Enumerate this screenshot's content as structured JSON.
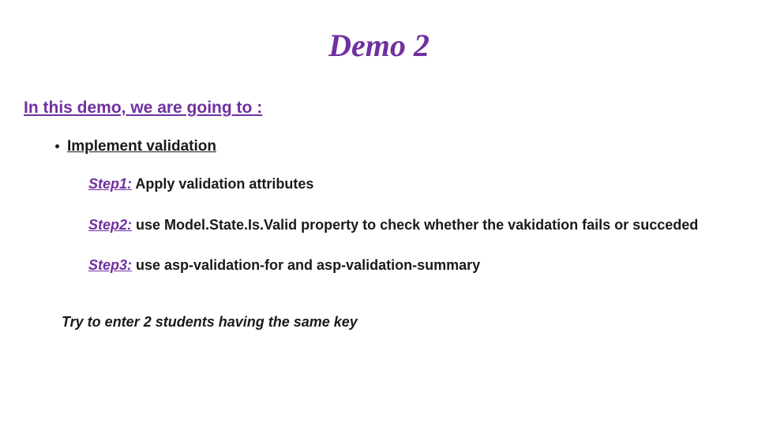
{
  "title": "Demo 2",
  "intro": "In this demo, we are going to :",
  "bullet": "Implement validation",
  "steps": [
    {
      "label": "Step1:",
      "body": " Apply validation attributes"
    },
    {
      "label": "Step2:",
      "body": " use Model.State.Is.Valid property to check whether the vakidation fails or succeded"
    },
    {
      "label": "Step3:",
      "body": " use asp-validation-for  and asp-validation-summary"
    }
  ],
  "note": "Try to enter 2 students having the same key"
}
